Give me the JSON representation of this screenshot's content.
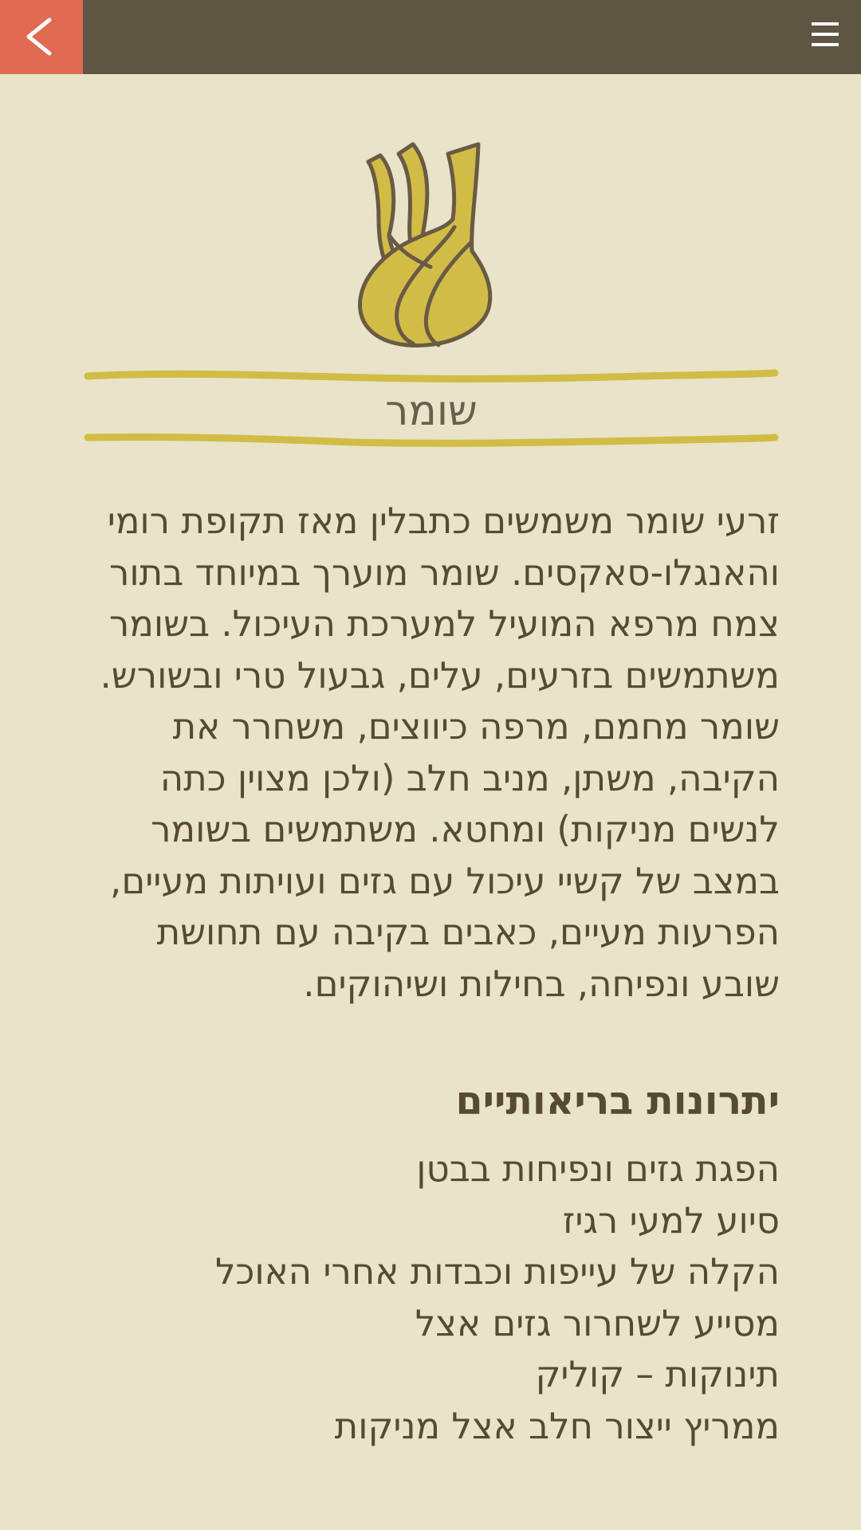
{
  "header": {
    "back_icon": "chevron-left-icon",
    "menu_icon": "hamburger-menu-icon",
    "back_color": "#e06a52",
    "bar_color": "#5e5643"
  },
  "herb": {
    "illustration_icon": "fennel-bulb-icon",
    "title": "שומר",
    "description": "זרעי שומר משמשים כתבלין מאז תקופת רומי והאנגלו-סאקסים. שומר מוערך במיוחד בתור צמח מרפא המועיל למערכת העיכול. בשומר משתמשים בזרעים, עלים, גבעול טרי ובשורש. שומר מחמם, מרפה כיווצים, משחרר את הקיבה, משתן, מניב חלב (ולכן מצוין כתה לנשים מניקות) ומחטא. משתמשים בשומר במצב של קשיי עיכול עם גזים ועויתות מעיים, הפרעות מעיים, כאבים בקיבה עם תחושת שובע ונפיחה, בחילות ושיהוקים."
  },
  "benefits": {
    "heading": "יתרונות בריאותיים",
    "items": [
      "הפגת גזים ונפיחות בבטן",
      "סיוע למעי רגיז",
      "הקלה של עייפות וכבדות אחרי האוכל",
      "מסייע לשחרור גזים אצל",
      "תינוקות – קוליק",
      "ממריץ ייצור חלב אצל מניקות"
    ]
  },
  "colors": {
    "background": "#e8e3c9",
    "accent_yellow": "#d1bd45",
    "text": "#574933"
  }
}
